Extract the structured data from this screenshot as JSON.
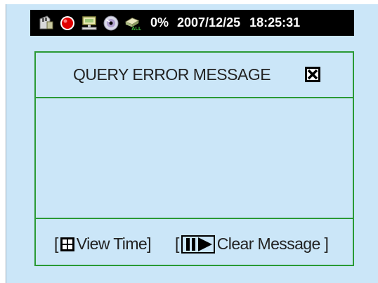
{
  "status_bar": {
    "icons": [
      "sd-card-icon",
      "record-indicator-icon",
      "network-icon",
      "disc-icon",
      "hdd-all-icon"
    ],
    "usage": "0%",
    "date": "2007/12/25",
    "time": "18:25:31"
  },
  "dialog": {
    "title": "QUERY ERROR MESSAGE",
    "close_icon": "close-box-icon",
    "footer": {
      "open_bracket": "[",
      "close_bracket": "]",
      "view_time_label": "View Time",
      "view_time_icon": "quad-grid-icon",
      "clear_label": "Clear Message",
      "clear_close_bracket": " ]",
      "clear_icon": "pause-play-icon"
    }
  },
  "colors": {
    "background": "#cbe6f8",
    "border_green": "#2a9a35",
    "status_bar": "#000000",
    "record_red": "#e00000"
  }
}
